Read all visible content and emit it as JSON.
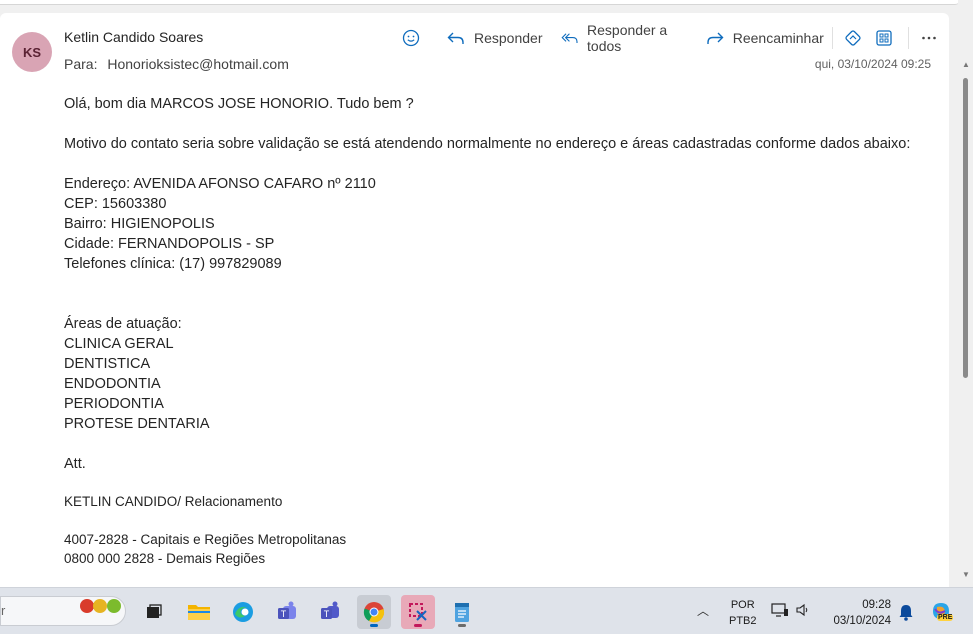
{
  "message": {
    "avatar_initials": "KS",
    "sender": "Ketlin Candido Soares",
    "to_label": "Para:",
    "to": "Honorioksistec@hotmail.com",
    "date": "qui, 03/10/2024 09:25",
    "actions": {
      "reply": "Responder",
      "reply_all": "Responder a todos",
      "forward": "Reencaminhar"
    },
    "body": {
      "greeting": "Olá, bom dia MARCOS JOSE HONORIO. Tudo bem ?",
      "motive": "Motivo do contato seria sobre validação se está atendendo normalmente no endereço e áreas cadastradas conforme dados abaixo:",
      "address_lines": [
        "Endereço: AVENIDA AFONSO CAFARO nº 2110",
        "CEP: 15603380",
        "Bairro: HIGIENOPOLIS",
        "Cidade: FERNANDOPOLIS - SP",
        "Telefones clínica: (17) 997829089"
      ],
      "areas_title": "Áreas de atuação:",
      "areas": [
        "CLINICA GERAL",
        "DENTISTICA",
        "ENDODONTIA",
        "PERIODONTIA",
        "PROTESE DENTARIA"
      ],
      "closing": "Att.",
      "signature": "KETLIN CANDIDO/ Relacionamento",
      "phones": [
        "4007-2828 - Capitais e Regiões Metropolitanas",
        "0800 000 2828 - Demais Regiões"
      ]
    }
  },
  "taskbar": {
    "search_fragment": "r",
    "language_line1": "POR",
    "language_line2": "PTB2",
    "time": "09:28",
    "date": "03/10/2024",
    "copilot_badge": "PRE",
    "colors": {
      "accent_blue": "#0f6cbd",
      "avatar_bg": "#d9a4b4"
    }
  }
}
